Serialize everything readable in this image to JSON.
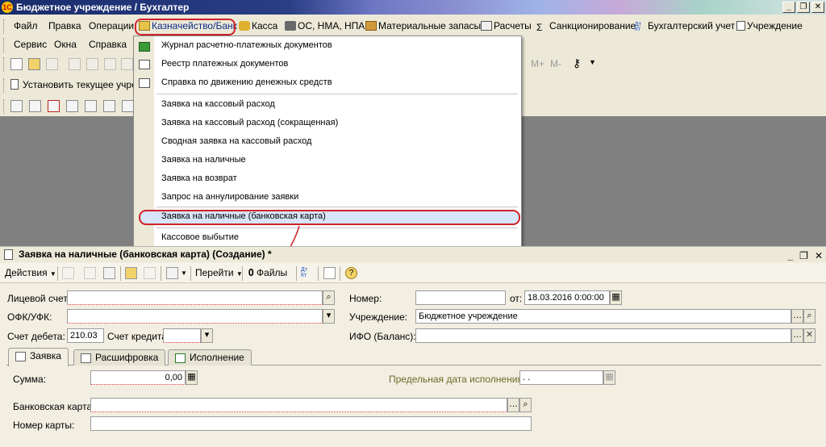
{
  "window": {
    "title": "Бюджетное учреждение / Бухгалтер",
    "app_icon": "1C",
    "controls": [
      "_",
      "❐",
      "✕"
    ]
  },
  "menubar": {
    "items": [
      {
        "label": "Файл",
        "icon": ""
      },
      {
        "label": "Правка",
        "icon": ""
      },
      {
        "label": "Операции",
        "icon": ""
      },
      {
        "label": "Казначейство/Банк",
        "icon": "bank-icon"
      },
      {
        "label": "Касса",
        "icon": "cash-icon"
      },
      {
        "label": "ОС, НМА, НПА",
        "icon": "truck-icon"
      },
      {
        "label": "Материальные запасы",
        "icon": "box-icon"
      },
      {
        "label": "Расчеты",
        "icon": "calc-icon"
      },
      {
        "label": "Санкционирование",
        "icon": "sigma-icon"
      },
      {
        "label": "Бухгалтерский учет",
        "icon": "dtkt-icon"
      },
      {
        "label": "Учреждение",
        "icon": "doc-icon"
      }
    ],
    "row2": [
      "Сервис",
      "Окна",
      "Справка"
    ]
  },
  "toolbar": {
    "set_current_label": "Установить текущее учреж",
    "calc_buttons": [
      "M+",
      "M-"
    ]
  },
  "dropdown": {
    "items": [
      {
        "label": "Журнал  расчетно-платежных документов",
        "icon": "journal-icon"
      },
      {
        "label": "Реестр платежных документов",
        "icon": "report-icon"
      },
      {
        "label": "Справка по движению денежных средств",
        "icon": "report-icon"
      },
      {
        "label": "Заявка на кассовый расход"
      },
      {
        "label": "Заявка на кассовый расход (сокращенная)"
      },
      {
        "label": "Сводная заявка на кассовый расход"
      },
      {
        "label": "Заявка на наличные"
      },
      {
        "label": "Заявка на возврат"
      },
      {
        "label": "Запрос на аннулирование заявки"
      },
      {
        "label": "Заявка на наличные (банковская карта)"
      },
      {
        "label": "Кассовое выбытие"
      }
    ]
  },
  "doc": {
    "title": "Заявка на наличные (банковская карта) (Создание) *",
    "toolbar": {
      "actions": "Действия",
      "goto": "Перейти",
      "files": "Файлы"
    },
    "fields": {
      "account_label": "Лицевой счет:",
      "account_value": "",
      "ofk_label": "ОФК/УФК:",
      "ofk_value": "",
      "debit_label": "Счет дебета:",
      "debit_value": "210.03",
      "credit_label": "Счет кредита:",
      "credit_value": "",
      "number_label": "Номер:",
      "number_value": "",
      "date_label": "от:",
      "date_value": "18.03.2016  0:00:00",
      "institution_label": "Учреждение:",
      "institution_value": "Бюджетное учреждение",
      "ifo_label": "ИФО (Баланс):",
      "ifo_value": ""
    },
    "tabs": [
      "Заявка",
      "Расшифровка",
      "Исполнение"
    ],
    "tab_content": {
      "sum_label": "Сумма:",
      "sum_value": "0,00",
      "deadline_label": "Предельная дата исполнения:",
      "deadline_value": " .  .",
      "card_label": "Банковская карта:",
      "card_value": "",
      "card_number_label": "Номер карты:",
      "card_number_value": ""
    }
  },
  "colors": {
    "highlight_oval": "#d0222a",
    "menu_active": "#d8e4f7",
    "label_green": "#6b6b2a"
  }
}
